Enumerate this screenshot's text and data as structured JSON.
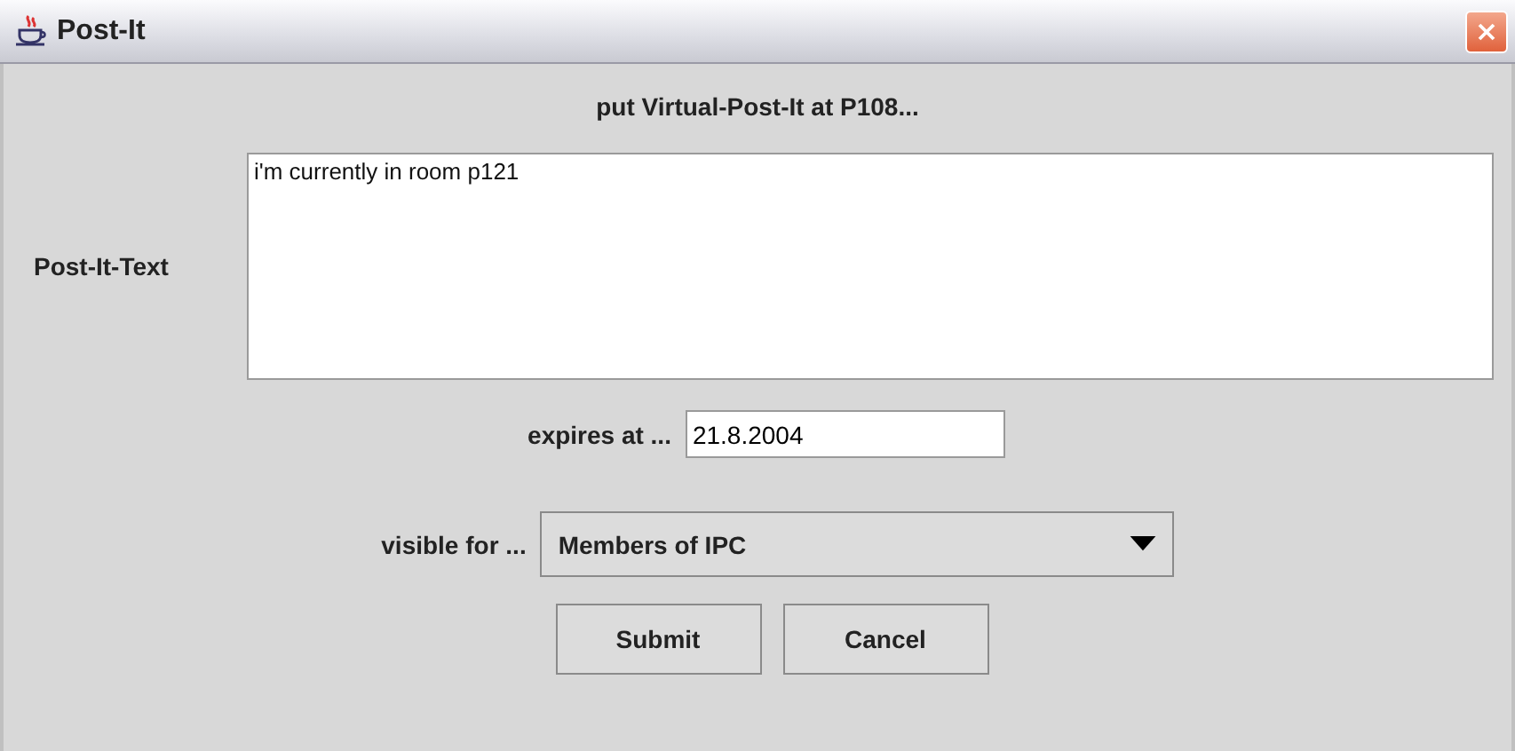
{
  "window": {
    "title": "Post-It"
  },
  "heading": "put Virtual-Post-It at P108...",
  "text_field": {
    "label": "Post-It-Text",
    "value": "i'm currently in room p121"
  },
  "expires": {
    "label": "expires at ...",
    "value": "21.8.2004"
  },
  "visibility": {
    "label": "visible for ...",
    "value": "Members of IPC"
  },
  "buttons": [
    "Submit",
    "Cancel"
  ]
}
